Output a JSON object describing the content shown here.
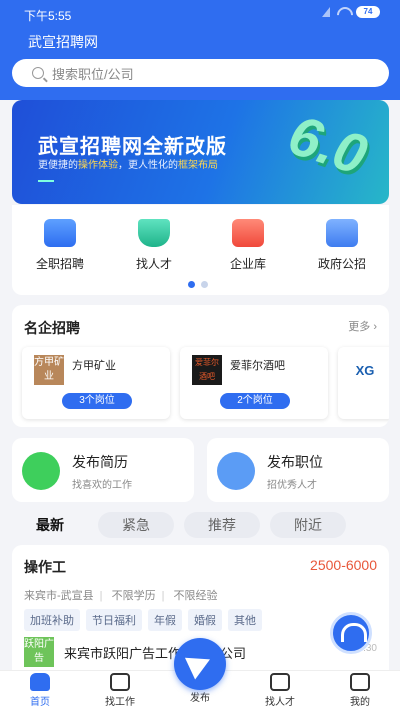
{
  "status": {
    "time": "下午5:55",
    "battery": "74"
  },
  "header": {
    "title": "武宣招聘网"
  },
  "search": {
    "placeholder": "搜索职位/公司"
  },
  "banner": {
    "title": "武宣招聘网全新改版",
    "subtitle_pre": "更便捷的",
    "subtitle_hl1": "操作体验",
    "subtitle_mid": "，更人性化的",
    "subtitle_hl2": "框架布局",
    "version": "6.0"
  },
  "categories": [
    {
      "label": "全职招聘",
      "icon": "briefcase-icon"
    },
    {
      "label": "找人才",
      "icon": "graduation-cap-icon"
    },
    {
      "label": "企业库",
      "icon": "company-book-icon"
    },
    {
      "label": "政府公招",
      "icon": "document-icon"
    }
  ],
  "famous": {
    "title": "名企招聘",
    "more": "更多",
    "companies": [
      {
        "name": "方甲矿业",
        "logo_text": "方甲矿业",
        "jobs": "3个岗位"
      },
      {
        "name": "爱菲尔酒吧",
        "logo_text": "爱菲尔酒吧",
        "jobs": "2个岗位"
      },
      {
        "name": "",
        "logo_text": "XG",
        "jobs": ""
      }
    ]
  },
  "post": {
    "resume_title": "发布简历",
    "resume_sub": "找喜欢的工作",
    "job_title": "发布职位",
    "job_sub": "招优秀人才"
  },
  "filters": [
    "最新",
    "紧急",
    "推荐",
    "附近"
  ],
  "job": {
    "title": "操作工",
    "salary": "2500-6000",
    "location": "来宾市-武宣县",
    "education": "不限学历",
    "experience": "不限经验",
    "tags": [
      "加班补助",
      "节日福利",
      "年假",
      "婚假",
      "其他"
    ],
    "company_logo": "跃阳广告",
    "company": "来宾市跃阳广告工作室有限公司",
    "time": "17:30"
  },
  "tabs": [
    "首页",
    "找工作",
    "发布",
    "找人才",
    "我的"
  ],
  "colors": {
    "primary": "#2f6df0",
    "salary": "#e8573a"
  }
}
